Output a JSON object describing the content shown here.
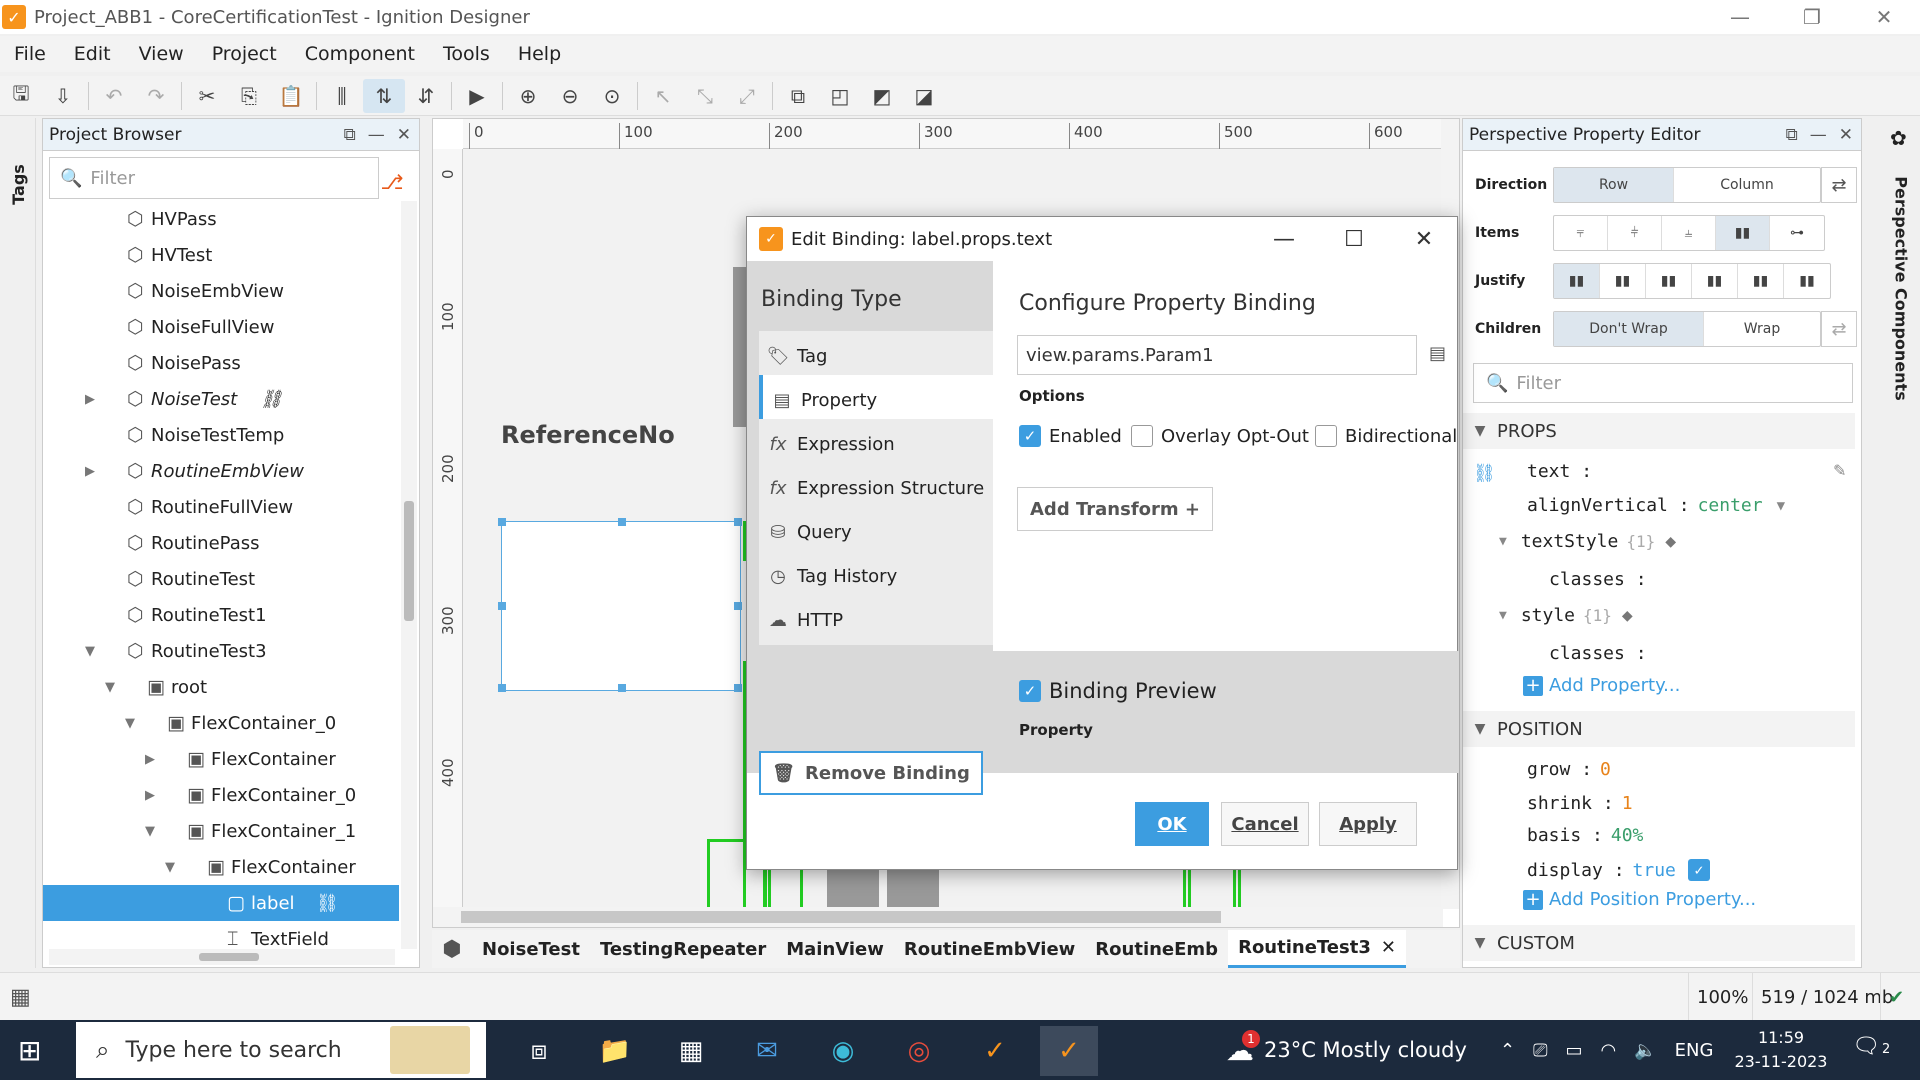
{
  "window": {
    "title": "Project_ABB1 - CoreCertificationTest - Ignition Designer",
    "logo": "ignition-logo",
    "controls": [
      "—",
      "❐",
      "✕"
    ]
  },
  "menu": [
    "File",
    "Edit",
    "View",
    "Project",
    "Component",
    "Tools",
    "Help"
  ],
  "toolbar": {
    "icons": [
      "save-icon",
      "save-all-icon",
      "undo-icon",
      "redo-icon",
      "cut-icon",
      "copy-icon",
      "paste-icon",
      "align-icon",
      "distribute-icon",
      "distribute-v-icon",
      "play-icon",
      "zoom-in-icon",
      "zoom-out-icon",
      "zoom-fit-icon",
      "select-icon",
      "pointer-icon",
      "pointer-alt-icon",
      "group-icon",
      "ungroup-icon",
      "front-icon",
      "back-icon"
    ]
  },
  "left_strip": {
    "tab": "Tags"
  },
  "project_browser": {
    "title": "Project Browser",
    "filter_placeholder": "Filter",
    "tree": [
      {
        "label": "HVPass",
        "level": 1,
        "icon": "view",
        "expander": ""
      },
      {
        "label": "HVTest",
        "level": 1,
        "icon": "view",
        "expander": ""
      },
      {
        "label": "NoiseEmbView",
        "level": 1,
        "icon": "view",
        "expander": ""
      },
      {
        "label": "NoiseFullView",
        "level": 1,
        "icon": "view",
        "expander": ""
      },
      {
        "label": "NoisePass",
        "level": 1,
        "icon": "view",
        "expander": ""
      },
      {
        "label": "NoiseTest",
        "level": 1,
        "icon": "view",
        "expander": "▶",
        "italic": true,
        "link": true
      },
      {
        "label": "NoiseTestTemp",
        "level": 1,
        "icon": "view",
        "expander": ""
      },
      {
        "label": "RoutineEmbView",
        "level": 1,
        "icon": "view",
        "expander": "▶",
        "italic": true
      },
      {
        "label": "RoutineFullView",
        "level": 1,
        "icon": "view",
        "expander": ""
      },
      {
        "label": "RoutinePass",
        "level": 1,
        "icon": "view",
        "expander": ""
      },
      {
        "label": "RoutineTest",
        "level": 1,
        "icon": "view",
        "expander": ""
      },
      {
        "label": "RoutineTest1",
        "level": 1,
        "icon": "view",
        "expander": ""
      },
      {
        "label": "RoutineTest3",
        "level": 1,
        "icon": "view",
        "expander": "▼"
      },
      {
        "label": "root",
        "level": 2,
        "icon": "container",
        "expander": "▼"
      },
      {
        "label": "FlexContainer_0",
        "level": 3,
        "icon": "container",
        "expander": "▼"
      },
      {
        "label": "FlexContainer",
        "level": 4,
        "icon": "container",
        "expander": "▶"
      },
      {
        "label": "FlexContainer_0",
        "level": 4,
        "icon": "container",
        "expander": "▶"
      },
      {
        "label": "FlexContainer_1",
        "level": 4,
        "icon": "container",
        "expander": "▼"
      },
      {
        "label": "FlexContainer",
        "level": 5,
        "icon": "container",
        "expander": "▼"
      },
      {
        "label": "label",
        "level": 6,
        "icon": "label",
        "expander": "",
        "selected": true,
        "link": true
      },
      {
        "label": "TextField",
        "level": 6,
        "icon": "textfield",
        "expander": ""
      }
    ]
  },
  "canvas": {
    "ruler_top": [
      "0",
      "100",
      "200",
      "300",
      "400",
      "500",
      "600"
    ],
    "ruler_left": [
      "0",
      "100",
      "200",
      "300",
      "400"
    ],
    "reference_label": "ReferenceNo"
  },
  "view_tabs": [
    "NoiseTest",
    "TestingRepeater",
    "MainView",
    "RoutineEmbView",
    "RoutineEmb",
    "RoutineTest3"
  ],
  "active_tab": "RoutineTest3",
  "dialog": {
    "title": "Edit Binding: label.props.text",
    "binding_type_title": "Binding Type",
    "binding_types": [
      {
        "label": "Tag",
        "icon": "🏷"
      },
      {
        "label": "Property",
        "icon": "▤"
      },
      {
        "label": "Expression",
        "icon": "fx"
      },
      {
        "label": "Expression Structure",
        "icon": "fx"
      },
      {
        "label": "Query",
        "icon": "⛁"
      },
      {
        "label": "Tag History",
        "icon": "◷"
      },
      {
        "label": "HTTP",
        "icon": "☁"
      }
    ],
    "active_binding": "Property",
    "remove_binding": "Remove Binding",
    "configure_title": "Configure Property Binding",
    "property_path": "view.params.Param1",
    "options_title": "Options",
    "options": [
      {
        "label": "Enabled",
        "checked": true
      },
      {
        "label": "Overlay Opt-Out",
        "checked": false
      },
      {
        "label": "Bidirectional",
        "checked": false
      }
    ],
    "add_transform": "Add Transform +",
    "preview_title": "Binding Preview",
    "preview_checked": true,
    "preview_sub": "Property",
    "buttons": {
      "ok": "OK",
      "cancel": "Cancel",
      "apply": "Apply"
    }
  },
  "property_editor": {
    "title": "Perspective Property Editor",
    "direction": {
      "label": "Direction",
      "options": [
        "Row",
        "Column"
      ],
      "selected": "Row"
    },
    "items_label": "Items",
    "justify_label": "Justify",
    "children": {
      "label": "Children",
      "options": [
        "Don't Wrap",
        "Wrap"
      ],
      "selected": "Don't Wrap"
    },
    "filter_placeholder": "Filter",
    "props_section": "PROPS",
    "props": {
      "text_key": "text",
      "align_key": "alignVertical",
      "align_value": "center",
      "textstyle_key": "textStyle",
      "textstyle_meta": "{1}",
      "classes_key": "classes",
      "style_key": "style",
      "style_meta": "{1}",
      "style_classes_key": "classes",
      "add_property": "Add Property..."
    },
    "position_section": "POSITION",
    "position": {
      "grow_key": "grow",
      "grow_value": "0",
      "shrink_key": "shrink",
      "shrink_value": "1",
      "basis_key": "basis",
      "basis_value": "40%",
      "display_key": "display",
      "display_value": "true",
      "add_position": "Add Position Property..."
    },
    "custom_section": "CUSTOM"
  },
  "right_strip": {
    "tab": "Perspective Components"
  },
  "statusbar": {
    "zoom": "100%",
    "memory": "519 / 1024 mb"
  },
  "taskbar": {
    "search_placeholder": "Type here to search",
    "weather": "23°C  Mostly cloudy",
    "language": "ENG",
    "time": "11:59",
    "date": "23-11-2023",
    "notifications": "2",
    "weather_badge": "1"
  },
  "colors": {
    "accent": "#3c9de0",
    "selection": "#3c9de0",
    "ignition_orange": "#f7941d",
    "green_frame": "#22cc22"
  }
}
